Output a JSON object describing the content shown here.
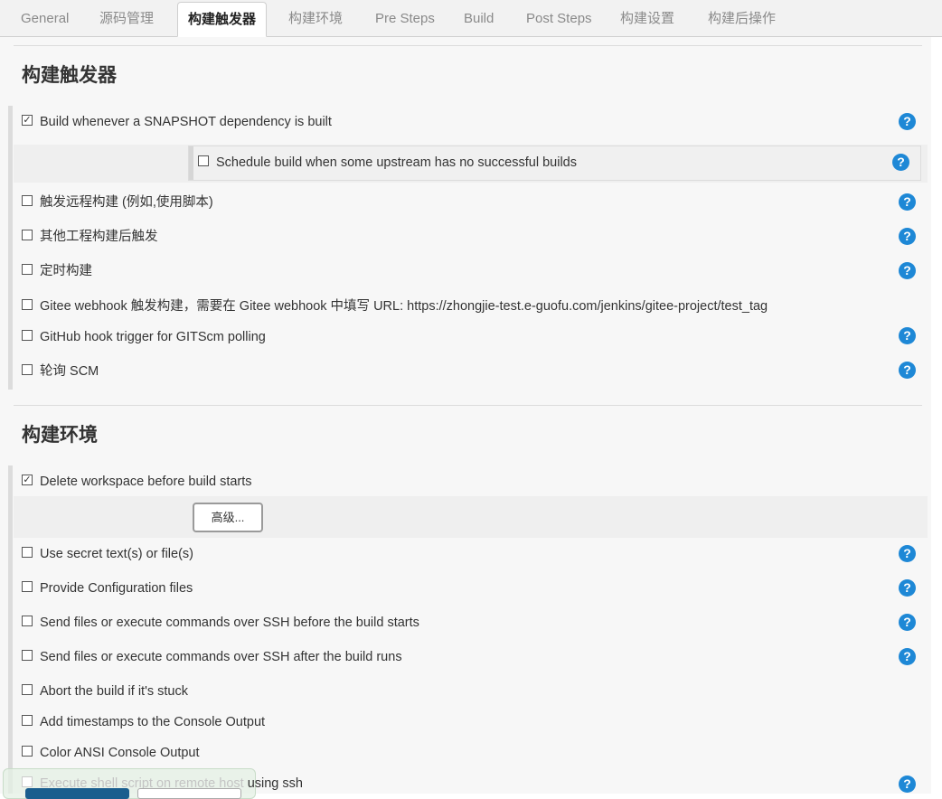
{
  "tabs": [
    {
      "label": "General"
    },
    {
      "label": "源码管理"
    },
    {
      "label": "构建触发器"
    },
    {
      "label": "构建环境"
    },
    {
      "label": "Pre Steps"
    },
    {
      "label": "Build"
    },
    {
      "label": "Post Steps"
    },
    {
      "label": "构建设置"
    },
    {
      "label": "构建后操作"
    }
  ],
  "active_tab": "构建触发器",
  "triggers": {
    "title": "构建触发器",
    "items": [
      {
        "label": "Build whenever a SNAPSHOT dependency is built",
        "checked": true
      },
      {
        "label": "Schedule build when some upstream has no successful builds",
        "checked": false
      },
      {
        "label": "触发远程构建 (例如,使用脚本)",
        "checked": false
      },
      {
        "label": "其他工程构建后触发",
        "checked": false
      },
      {
        "label": "定时构建",
        "checked": false
      },
      {
        "label": "Gitee webhook 触发构建，需要在 Gitee webhook 中填写 URL: https://zhongjie-test.e-guofu.com/jenkins/gitee-project/test_tag",
        "checked": false
      },
      {
        "label": "GitHub hook trigger for GITScm polling",
        "checked": false
      },
      {
        "label": "轮询 SCM",
        "checked": false
      }
    ]
  },
  "environment": {
    "title": "构建环境",
    "advanced_label": "高级...",
    "items": [
      {
        "label": "Delete workspace before build starts",
        "checked": true
      },
      {
        "label": "Use secret text(s) or file(s)",
        "checked": false
      },
      {
        "label": "Provide Configuration files",
        "checked": false
      },
      {
        "label": "Send files or execute commands over SSH before the build starts",
        "checked": false
      },
      {
        "label": "Send files or execute commands over SSH after the build runs",
        "checked": false
      },
      {
        "label": "Abort the build if it's stuck",
        "checked": false
      },
      {
        "label": "Add timestamps to the Console Output",
        "checked": false
      },
      {
        "label": "Color ANSI Console Output",
        "checked": false
      }
    ],
    "last_item": {
      "label_faded": "Execute shell script on remote host",
      "label_rest": " using ssh",
      "checked": false
    }
  },
  "help_icon_glyph": "?",
  "checked_glyph": "✓",
  "colors": {
    "help": "#1e88d6",
    "save_button": "#1a5e8e"
  }
}
